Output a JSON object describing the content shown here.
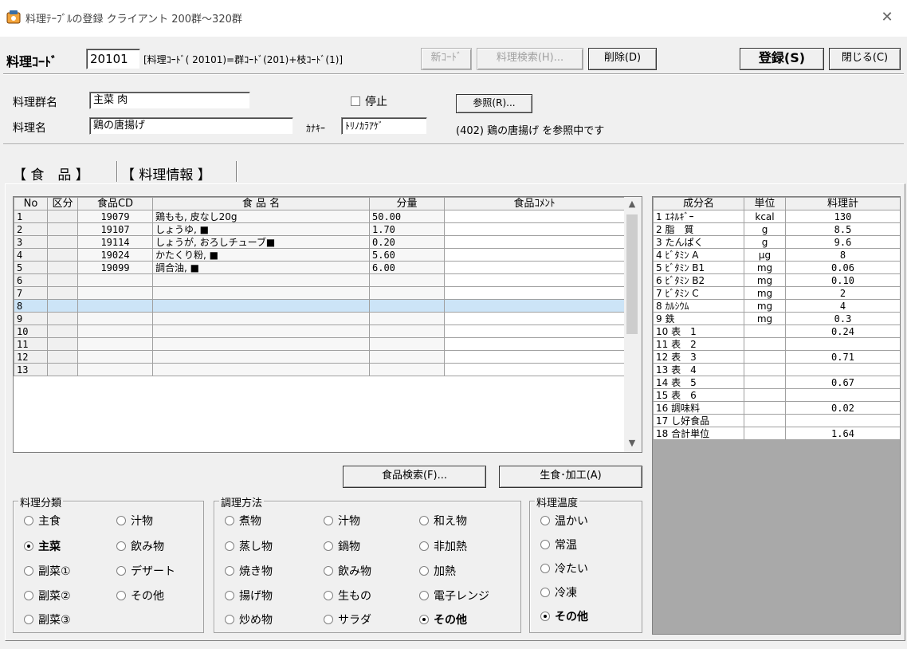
{
  "window": {
    "title": "料理ﾃｰﾌﾞﾙの登録 クライアント 200群～320群",
    "close_icon": "close-icon"
  },
  "toolbar": {
    "code_label": "料理ｺｰﾄﾞ",
    "code_value": "20101",
    "code_hint": "[料理ｺｰﾄﾞ( 20101)=群ｺｰﾄﾞ(201)+枝ｺｰﾄﾞ(1)]",
    "new_code": "新ｺｰﾄﾞ",
    "search": "料理検索(H)...",
    "delete": "削除(D)",
    "register": "登録(S)",
    "close": "閉じる(C)"
  },
  "header": {
    "group_label": "料理群名",
    "group_value": "主菜 肉",
    "stop_label": "停止",
    "ref_button": "参照(R)...",
    "name_label": "料理名",
    "name_value": "鶏の唐揚げ",
    "kana_label": "ｶﾅｷｰ",
    "kana_value": "ﾄﾘﾉｶﾗｱｹﾞ",
    "ref_status": "(402) 鶏の唐揚げ を参照中です"
  },
  "tabs": {
    "food": "【 食　品 】",
    "info": "【 料理情報 】"
  },
  "foods": {
    "headers": [
      "No",
      "区分",
      "食品CD",
      "食 品 名",
      "分量",
      "食品ｺﾒﾝﾄ"
    ],
    "rows": [
      {
        "no": "1",
        "kubun": "",
        "cd": "19079",
        "name": "鶏もも, 皮なし20g",
        "qty": "50.00",
        "comment": ""
      },
      {
        "no": "2",
        "kubun": "",
        "cd": "19107",
        "name": "しょうゆ, ■",
        "qty": "1.70",
        "comment": ""
      },
      {
        "no": "3",
        "kubun": "",
        "cd": "19114",
        "name": "しょうが, おろしチューブ■",
        "qty": "0.20",
        "comment": ""
      },
      {
        "no": "4",
        "kubun": "",
        "cd": "19024",
        "name": "かたくり粉, ■",
        "qty": "5.60",
        "comment": ""
      },
      {
        "no": "5",
        "kubun": "",
        "cd": "19099",
        "name": "調合油, ■",
        "qty": "6.00",
        "comment": ""
      },
      {
        "no": "6",
        "kubun": "",
        "cd": "",
        "name": "",
        "qty": "",
        "comment": ""
      },
      {
        "no": "7",
        "kubun": "",
        "cd": "",
        "name": "",
        "qty": "",
        "comment": ""
      },
      {
        "no": "8",
        "kubun": "",
        "cd": "",
        "name": "",
        "qty": "",
        "comment": ""
      },
      {
        "no": "9",
        "kubun": "",
        "cd": "",
        "name": "",
        "qty": "",
        "comment": ""
      },
      {
        "no": "10",
        "kubun": "",
        "cd": "",
        "name": "",
        "qty": "",
        "comment": ""
      },
      {
        "no": "11",
        "kubun": "",
        "cd": "",
        "name": "",
        "qty": "",
        "comment": ""
      },
      {
        "no": "12",
        "kubun": "",
        "cd": "",
        "name": "",
        "qty": "",
        "comment": ""
      },
      {
        "no": "13",
        "kubun": "",
        "cd": "",
        "name": "",
        "qty": "",
        "comment": ""
      }
    ],
    "selected_row": "8"
  },
  "buttons": {
    "food_search": "食品検索(F)...",
    "raw_processed": "生食･加工(A)"
  },
  "nutrients": {
    "headers": [
      "成分名",
      "単位",
      "料理計"
    ],
    "rows": [
      {
        "name": "1 ｴﾈﾙｷﾞｰ",
        "unit": "kcal",
        "value": "130"
      },
      {
        "name": "2 脂　質",
        "unit": "g",
        "value": "8.5"
      },
      {
        "name": "3 たんぱく",
        "unit": "g",
        "value": "9.6"
      },
      {
        "name": "4 ﾋﾞﾀﾐﾝ A",
        "unit": "μg",
        "value": "8"
      },
      {
        "name": "5 ﾋﾞﾀﾐﾝ B1",
        "unit": "mg",
        "value": "0.06"
      },
      {
        "name": "6 ﾋﾞﾀﾐﾝ B2",
        "unit": "mg",
        "value": "0.10"
      },
      {
        "name": "7 ﾋﾞﾀﾐﾝ C",
        "unit": "mg",
        "value": "2"
      },
      {
        "name": "8 ｶﾙｼｳﾑ",
        "unit": "mg",
        "value": "4"
      },
      {
        "name": "9 鉄",
        "unit": "mg",
        "value": "0.3"
      },
      {
        "name": "10 表　1",
        "unit": "",
        "value": "0.24"
      },
      {
        "name": "11 表　2",
        "unit": "",
        "value": ""
      },
      {
        "name": "12 表　3",
        "unit": "",
        "value": "0.71"
      },
      {
        "name": "13 表　4",
        "unit": "",
        "value": ""
      },
      {
        "name": "14 表　5",
        "unit": "",
        "value": "0.67"
      },
      {
        "name": "15 表　6",
        "unit": "",
        "value": ""
      },
      {
        "name": "16 調味料",
        "unit": "",
        "value": "0.02"
      },
      {
        "name": "17 し好食品",
        "unit": "",
        "value": ""
      },
      {
        "name": "18 合計単位",
        "unit": "",
        "value": "1.64"
      }
    ]
  },
  "category": {
    "title": "料理分類",
    "options": [
      "主食",
      "汁物",
      "主菜",
      "飲み物",
      "副菜①",
      "デザート",
      "副菜②",
      "その他",
      "副菜③"
    ],
    "selected": "主菜"
  },
  "method": {
    "title": "調理方法",
    "options": [
      "煮物",
      "汁物",
      "和え物",
      "蒸し物",
      "鍋物",
      "非加熱",
      "焼き物",
      "飲み物",
      "加熱",
      "揚げ物",
      "生もの",
      "電子レンジ",
      "炒め物",
      "サラダ",
      "その他"
    ],
    "selected": "その他"
  },
  "temperature": {
    "title": "料理温度",
    "options": [
      "温かい",
      "常温",
      "冷たい",
      "冷凍",
      "その他"
    ],
    "selected": "その他"
  }
}
